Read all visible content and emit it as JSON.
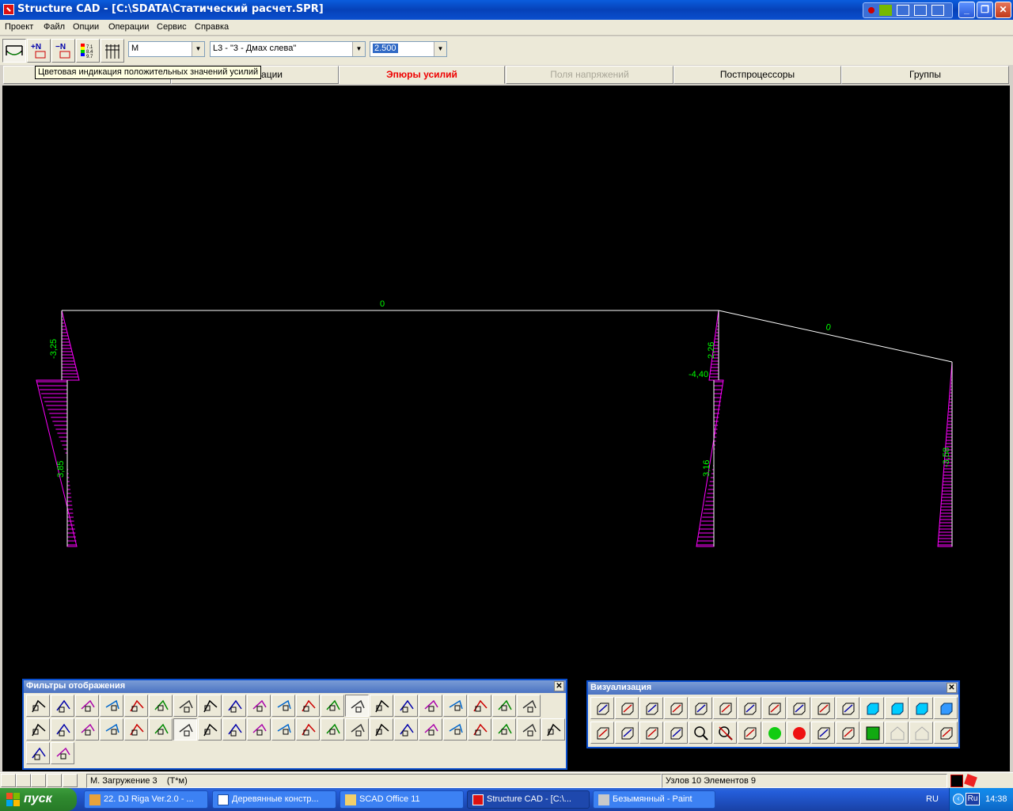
{
  "window": {
    "title": "Structure CAD  - [C:\\SDATA\\Статический расчет.SPR]",
    "min_label": "_",
    "restore_label": "❐",
    "close_label": "✕"
  },
  "menu": [
    "Проект",
    "Файл",
    "Опции",
    "Операции",
    "Сервис",
    "Справка"
  ],
  "toolbar": {
    "factor_combo": "M",
    "load_combo": "L3 - \"3 - Дмах слева\"",
    "scale_combo": "2.500"
  },
  "tooltip": "Цветовая индикация положительных значений усилий",
  "tabs": [
    {
      "label": "",
      "state": "normal"
    },
    {
      "label": "ации",
      "state": "normal"
    },
    {
      "label": "Эпюры усилий",
      "state": "active"
    },
    {
      "label": "Поля напряжений",
      "state": "disabled"
    },
    {
      "label": "Постпроцессоры",
      "state": "normal"
    },
    {
      "label": "Группы",
      "state": "normal"
    }
  ],
  "diagram": {
    "line_color": "#ffffff",
    "fill_color": "#ff00ff",
    "label_color": "#00ff00",
    "labels": {
      "beam_left": "0",
      "beam_right": "0",
      "col1_top": "-3,25",
      "col1_mid": "3,85",
      "col2_top": "2,26",
      "col2_node": "-4,40",
      "col2_mid": "3,16",
      "col3_mid": "-3,58"
    }
  },
  "filters_panel": {
    "title": "Фильтры отображения",
    "close_label": "✕"
  },
  "viz_panel": {
    "title": "Визуализация",
    "close_label": "✕"
  },
  "status": {
    "load": "M. Загружение 3",
    "units": "(T*м)",
    "counts": "Узлов 10 Элементов 9"
  },
  "taskbar": {
    "start": "пуск",
    "tasks": [
      {
        "label": "22. DJ Riga Ver.2.0 - ...",
        "active": false
      },
      {
        "label": "Деревянные констр...",
        "active": false
      },
      {
        "label": "SCAD Office 11",
        "active": false
      },
      {
        "label": "Structure CAD  - [C:\\...",
        "active": true
      },
      {
        "label": "Безымянный - Paint",
        "active": false
      }
    ],
    "lang": "RU",
    "tray_lang": "Ru",
    "clock": "14:38"
  }
}
